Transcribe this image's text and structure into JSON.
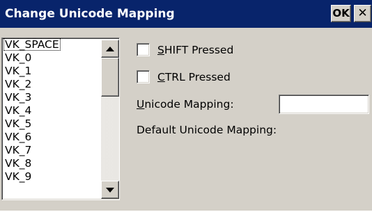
{
  "window": {
    "title": "Change Unicode Mapping",
    "ok_label": "OK",
    "close_label": "✕",
    "title_bar_color": "#08246b",
    "background_color": "#d4d0c8"
  },
  "key_list": {
    "items": [
      "VK_SPACE",
      "VK_0",
      "VK_1",
      "VK_2",
      "VK_3",
      "VK_4",
      "VK_5",
      "VK_6",
      "VK_7",
      "VK_8",
      "VK_9"
    ],
    "focused_item": "VK_SPACE",
    "scroll_up_icon": "triangle-up",
    "scroll_down_icon": "triangle-down"
  },
  "options": {
    "shift": {
      "mnemonic": "S",
      "rest": "HIFT Pressed",
      "checked": false
    },
    "ctrl": {
      "mnemonic": "C",
      "rest": "TRL Pressed",
      "checked": false
    }
  },
  "unicode_mapping": {
    "label_mnemonic": "U",
    "label_rest": "nicode Mapping:",
    "value": ""
  },
  "default_unicode_mapping": {
    "label": "Default Unicode Mapping:"
  }
}
